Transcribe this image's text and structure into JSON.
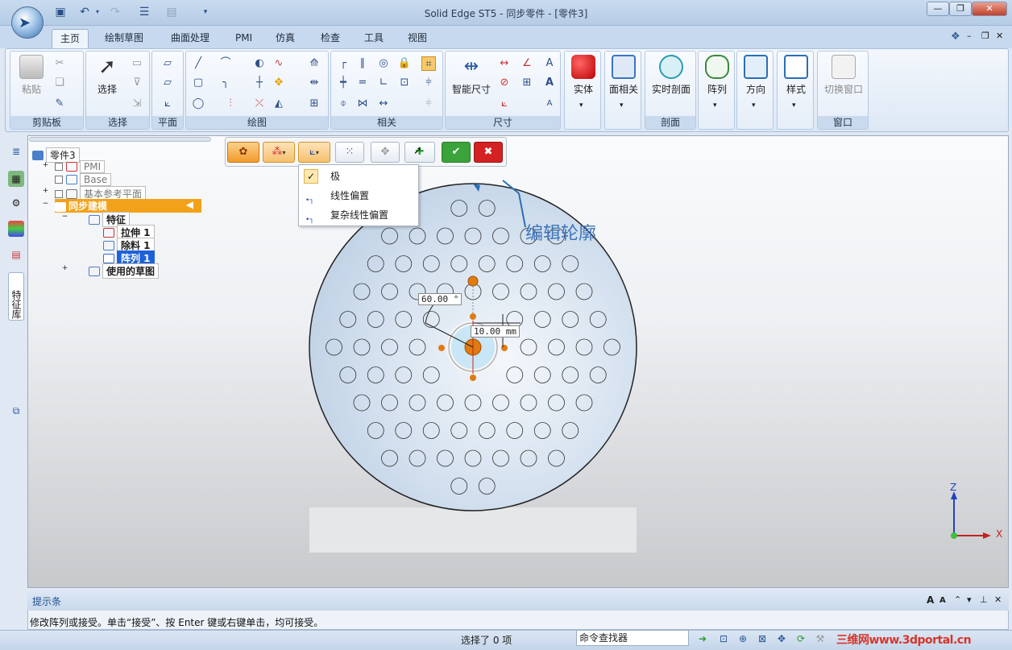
{
  "window": {
    "title": "Solid Edge ST5 - 同步零件 - [零件3]"
  },
  "tabs": [
    "主页",
    "绘制草图",
    "曲面处理",
    "PMI",
    "仿真",
    "检查",
    "工具",
    "视图"
  ],
  "active_tab": "主页",
  "ribbon": {
    "groups": [
      "剪贴板",
      "选择",
      "平面",
      "绘图",
      "相关",
      "尺寸",
      "剖面",
      "窗口"
    ],
    "buttons": {
      "paste": "粘贴",
      "select": "选择",
      "smart_dimension": "智能尺寸",
      "solid": "实体",
      "face_related": "面相关",
      "live_section": "实时剖面",
      "pattern": "阵列",
      "orientation": "方向",
      "styles": "样式",
      "switch_window": "切换窗口"
    }
  },
  "tree": {
    "root": "零件3",
    "items": [
      {
        "label": "PMI"
      },
      {
        "label": "Base"
      },
      {
        "label": "基本参考平面"
      },
      {
        "label": "同步建模"
      },
      {
        "label": "特征"
      },
      {
        "label": "拉伸 1"
      },
      {
        "label": "除料 1"
      },
      {
        "label": "阵列 1"
      },
      {
        "label": "使用的草图"
      }
    ]
  },
  "side_panel": {
    "features_label": "特征库"
  },
  "dropdown": {
    "items": [
      {
        "label": "极",
        "checked": true
      },
      {
        "label": "线性偏置",
        "checked": false
      },
      {
        "label": "复杂线性偏置",
        "checked": false
      }
    ]
  },
  "canvas": {
    "annotation": "编辑轮廓",
    "angle_dimension": "60.00 °",
    "radius_dimension": "10.00 mm",
    "triad": {
      "z": "Z",
      "x": "X"
    }
  },
  "hint": {
    "title": "提示条",
    "text": "修改阵列或接受。单击“接受”、按 Enter 键或右键单击，均可接受。"
  },
  "status": {
    "selection": "选择了 0 项",
    "command_finder": "命令查找器"
  },
  "watermark": "三维网www.3dportal.cn",
  "colors": {
    "accent_orange": "#f0a41c",
    "accept_green": "#3aa33a",
    "cancel_red": "#d42121"
  }
}
